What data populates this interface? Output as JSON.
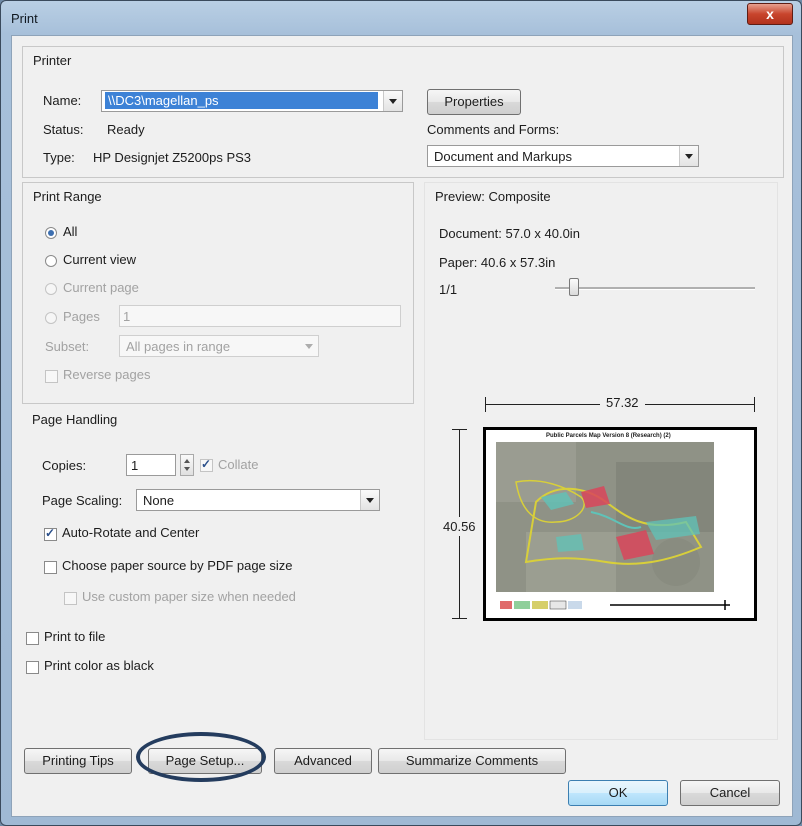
{
  "window": {
    "title": "Print",
    "close_glyph": "x"
  },
  "printer": {
    "group_title": "Printer",
    "name_label": "Name:",
    "name_value": "\\\\DC3\\magellan_ps",
    "properties_label": "Properties",
    "status_label": "Status:",
    "status_value": "Ready",
    "type_label": "Type:",
    "type_value": "HP Designjet Z5200ps PS3",
    "comments_label": "Comments and Forms:",
    "comments_value": "Document and Markups"
  },
  "print_range": {
    "group_title": "Print Range",
    "all_label": "All",
    "current_view_label": "Current view",
    "current_page_label": "Current page",
    "pages_label": "Pages",
    "pages_value": "1",
    "subset_label": "Subset:",
    "subset_value": "All pages in range",
    "reverse_label": "Reverse pages",
    "selected": "All"
  },
  "page_handling": {
    "group_title": "Page Handling",
    "copies_label": "Copies:",
    "copies_value": "1",
    "collate_label": "Collate",
    "scaling_label": "Page Scaling:",
    "scaling_value": "None",
    "auto_rotate_label": "Auto-Rotate and Center",
    "auto_rotate_checked": true,
    "paper_source_label": "Choose paper source by PDF page size",
    "custom_paper_label": "Use custom paper size when needed"
  },
  "output": {
    "print_to_file_label": "Print to file",
    "color_as_black_label": "Print color as black"
  },
  "preview": {
    "title": "Preview: Composite",
    "document_size": "Document: 57.0 x 40.0in",
    "paper_size": "Paper: 40.6 x 57.3in",
    "page_indicator": "1/1",
    "width_dim": "57.32",
    "height_dim": "40.56",
    "thumbnail_title": "Public Parcels Map Version 8 (Research) (2)"
  },
  "buttons": {
    "printing_tips": "Printing Tips",
    "page_setup": "Page Setup...",
    "advanced": "Advanced",
    "summarize_comments": "Summarize Comments",
    "ok": "OK",
    "cancel": "Cancel"
  },
  "colors": {
    "selection": "#3d82d6",
    "annotation_ring": "#243c5e"
  }
}
